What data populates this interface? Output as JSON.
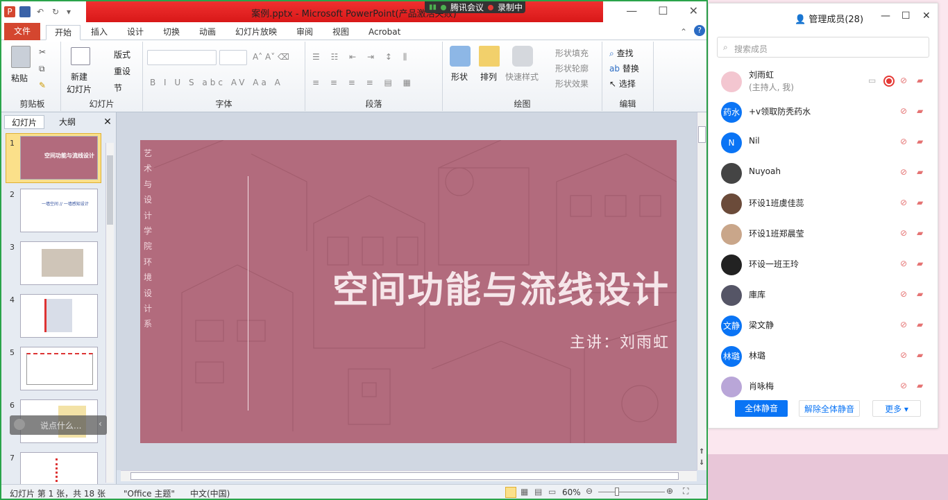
{
  "window": {
    "title": "案例.pptx - Microsoft PowerPoint(产品激活失败)"
  },
  "meeting_bar": {
    "app": "腾讯会议",
    "recording": "录制中"
  },
  "ribbon_tabs": [
    "文件",
    "开始",
    "插入",
    "设计",
    "切换",
    "动画",
    "幻灯片放映",
    "审阅",
    "视图",
    "Acrobat"
  ],
  "ribbon": {
    "clipboard": {
      "label": "剪贴板",
      "paste": "粘贴"
    },
    "slides": {
      "label": "幻灯片",
      "new_slide": "新建",
      "new_slide2": "幻灯片",
      "layout": "版式",
      "reset": "重设",
      "section": "节"
    },
    "font": {
      "label": "字体"
    },
    "paragraph": {
      "label": "段落"
    },
    "drawing": {
      "label": "绘图",
      "shapes": "形状",
      "arrange": "排列",
      "quick_styles": "快速样式",
      "fill": "形状填充",
      "outline": "形状轮廓",
      "effects": "形状效果"
    },
    "editing": {
      "label": "编辑",
      "find": "查找",
      "replace": "替换",
      "select": "选择"
    }
  },
  "left_pane": {
    "tab_slides": "幻灯片",
    "tab_outline": "大纲",
    "slide_numbers": [
      "1",
      "2",
      "3",
      "4",
      "5",
      "6",
      "7"
    ]
  },
  "slide": {
    "vertical_text": [
      "艺",
      "术",
      "与",
      "设",
      "计",
      "学",
      "院",
      "环",
      "境",
      "设",
      "计",
      "系"
    ],
    "title": "空间功能与流线设计",
    "subtitle": "主讲：刘雨虹"
  },
  "thumb1": {
    "title": "空间功能与流线设计"
  },
  "thumb2": {
    "title": "一墙空间 // 一墙感知设计"
  },
  "chat": {
    "placeholder": "说点什么..."
  },
  "status": {
    "slide_info": "幻灯片 第 1 张，共 18 张",
    "theme": "\"Office 主题\"",
    "lang": "中文(中国)",
    "zoom": "60%"
  },
  "members_panel": {
    "title": "管理成员(28)",
    "search_placeholder": "搜索成员",
    "members": [
      {
        "name": "刘雨虹",
        "role": "(主持人, 我)",
        "avatar": ""
      },
      {
        "name": "+v领取防秃药水",
        "avatar": "药水"
      },
      {
        "name": "Nil",
        "avatar": "N"
      },
      {
        "name": "Nuyoah",
        "avatar": ""
      },
      {
        "name": "环设1班虞佳蕊",
        "avatar": ""
      },
      {
        "name": "环设1班郑晨莹",
        "avatar": ""
      },
      {
        "name": "环设一班王玲",
        "avatar": ""
      },
      {
        "name": "庫库",
        "avatar": ""
      },
      {
        "name": "梁文静",
        "avatar": "文静"
      },
      {
        "name": "林璐",
        "avatar": "林璐"
      },
      {
        "name": "肖咏梅",
        "avatar": ""
      }
    ],
    "buttons": {
      "mute_all": "全体静音",
      "unmute_all": "解除全体静音",
      "more": "更多"
    }
  },
  "colors": {
    "accent": "#0a74f5",
    "ppt_red": "#d4462f",
    "slide_bg": "#b26b7d"
  }
}
